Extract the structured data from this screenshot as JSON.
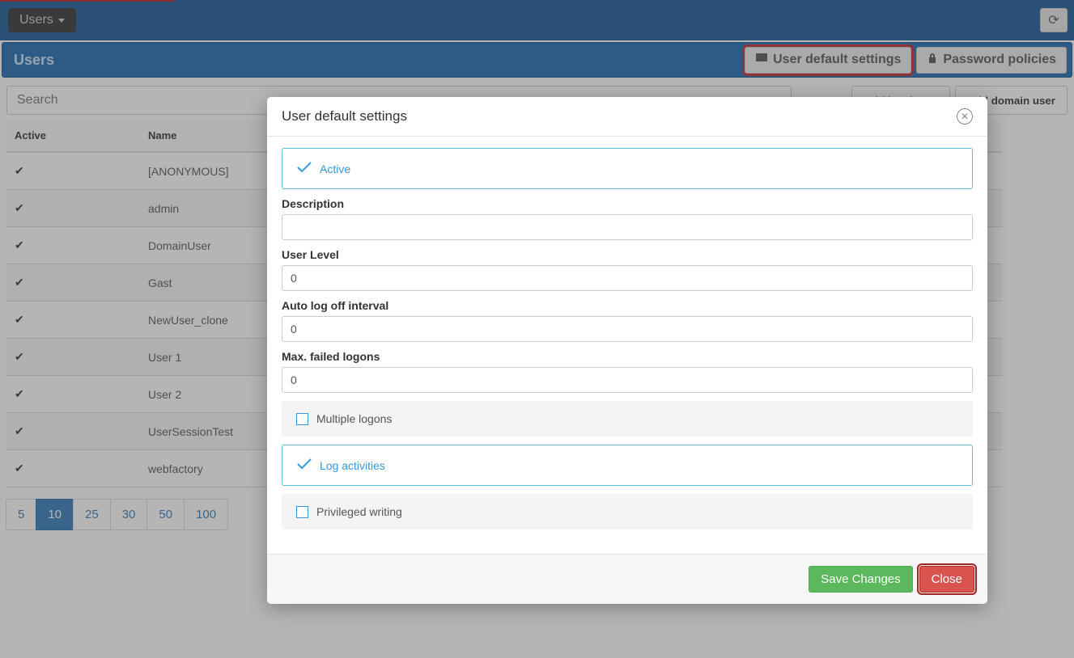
{
  "topbar": {
    "dropdown_label": "Users"
  },
  "page": {
    "title": "Users",
    "action_default_settings": "User default settings",
    "action_password_policies": "Password policies"
  },
  "search": {
    "placeholder": "Search"
  },
  "add_local_label": "Add local user",
  "add_domain_label": "Add domain user",
  "table": {
    "col_active": "Active",
    "col_name": "Name",
    "rows": [
      {
        "active": true,
        "name": "[ANONYMOUS]"
      },
      {
        "active": true,
        "name": "admin"
      },
      {
        "active": true,
        "name": "DomainUser"
      },
      {
        "active": true,
        "name": "Gast"
      },
      {
        "active": true,
        "name": "NewUser_clone"
      },
      {
        "active": true,
        "name": "User 1"
      },
      {
        "active": true,
        "name": "User 2"
      },
      {
        "active": true,
        "name": "UserSessionTest"
      },
      {
        "active": true,
        "name": "webfactory"
      }
    ]
  },
  "pager": {
    "sizes": [
      "5",
      "10",
      "25",
      "30",
      "50",
      "100"
    ],
    "active": "10"
  },
  "modal": {
    "title": "User default settings",
    "chk_active": "Active",
    "lbl_description": "Description",
    "val_description": "",
    "lbl_user_level": "User Level",
    "val_user_level": "0",
    "lbl_auto_logoff": "Auto log off interval",
    "val_auto_logoff": "0",
    "lbl_max_failed": "Max. failed logons",
    "val_max_failed": "0",
    "chk_multiple_logons": "Multiple logons",
    "chk_log_activities": "Log activities",
    "chk_privileged_writing": "Privileged writing",
    "btn_save": "Save Changes",
    "btn_close": "Close"
  }
}
